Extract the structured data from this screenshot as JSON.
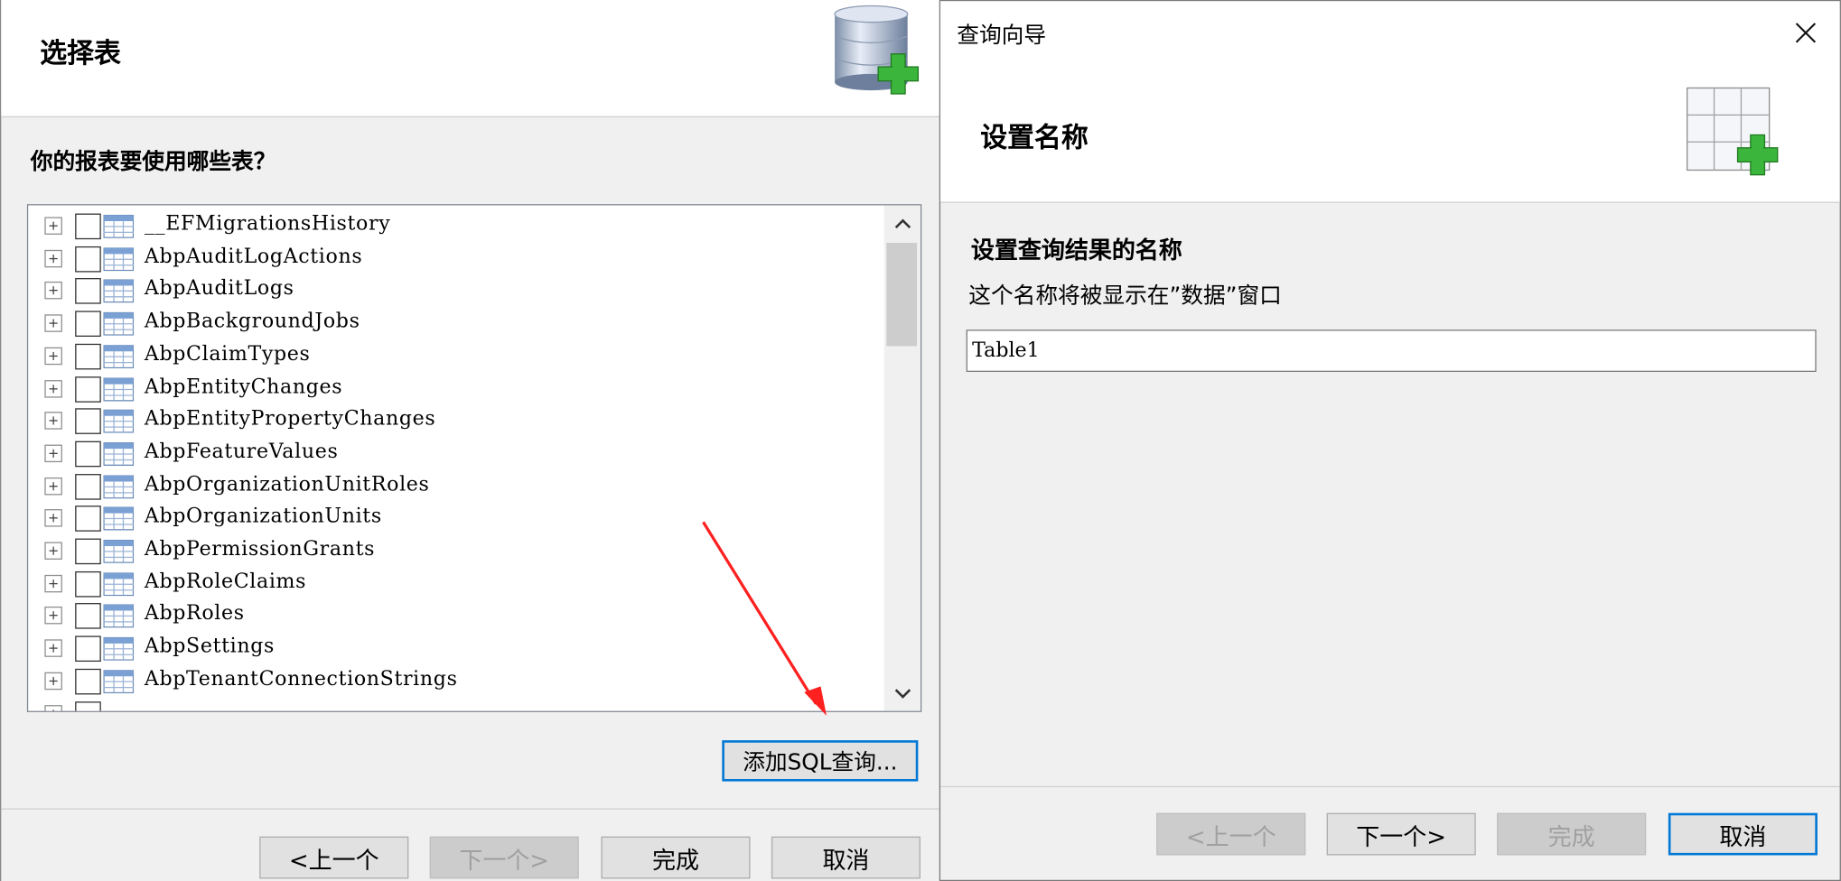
{
  "left_wizard": {
    "title": "选择表",
    "question": "你的报表要使用哪些表？",
    "tables": [
      "__EFMigrationsHistory",
      "AbpAuditLogActions",
      "AbpAuditLogs",
      "AbpBackgroundJobs",
      "AbpClaimTypes",
      "AbpEntityChanges",
      "AbpEntityPropertyChanges",
      "AbpFeatureValues",
      "AbpOrganizationUnitRoles",
      "AbpOrganizationUnits",
      "AbpPermissionGrants",
      "AbpRoleClaims",
      "AbpRoles",
      "AbpSettings",
      "AbpTenantConnectionStrings"
    ],
    "add_sql_label": "添加SQL查询...",
    "buttons": {
      "prev": "<上一个",
      "next": "下一个>",
      "finish": "完成",
      "cancel": "取消"
    }
  },
  "right_dialog": {
    "window_title": "查询向导",
    "title": "设置名称",
    "section_title": "设置查询结果的名称",
    "description": "这个名称将被显示在”数据”窗口",
    "name_value": "Table1",
    "buttons": {
      "prev": "<上一个",
      "next": "下一个>",
      "finish": "完成",
      "cancel": "取消"
    }
  },
  "colors": {
    "dialog_bg": "#f0f0f0",
    "focus_border": "#0078d7",
    "arrow": "#ff2020",
    "plus_green": "#3cb53c"
  }
}
